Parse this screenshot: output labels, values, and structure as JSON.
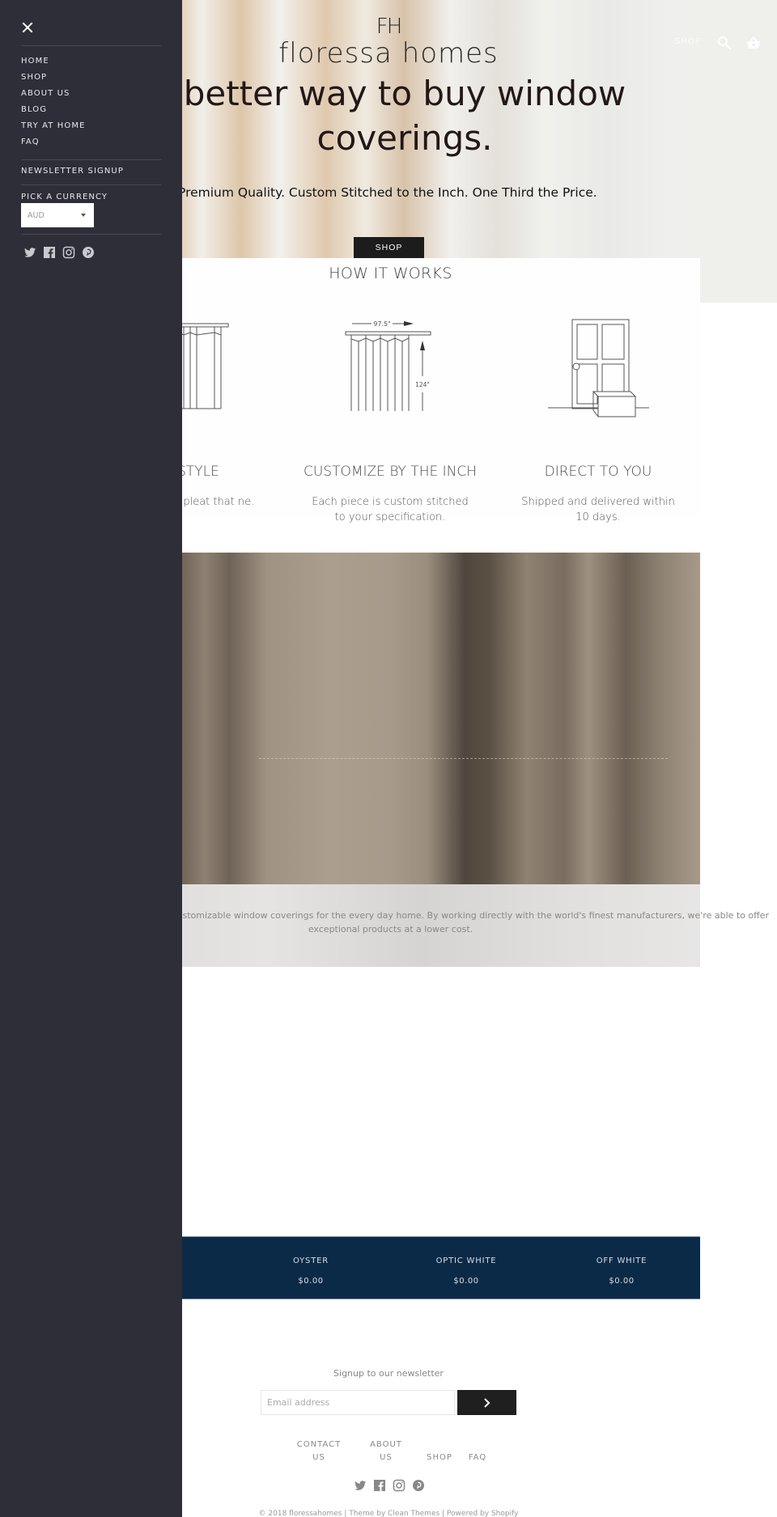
{
  "header": {
    "logo_mark": "FH",
    "logo_text": "floressa homes",
    "nav_shop": "SHOP",
    "search_icon": "search-icon",
    "cart_icon": "basket-icon"
  },
  "hero": {
    "title": "better way to buy window coverings.",
    "subtitle": "Premium Quality. Custom Stitched to the Inch. One Third the Price.",
    "cta_label": "SHOP"
  },
  "how_it_works": {
    "title": "HOW IT WORKS",
    "steps": [
      {
        "title": "STYLE",
        "description": "nd pleat that ne.",
        "icon": "curtain-icon"
      },
      {
        "title": "CUSTOMIZE BY THE INCH",
        "description": "Each piece is custom stitched to your specification.",
        "icon": "curtain-measure-icon",
        "width_label": "97.5\"",
        "height_label": "124\""
      },
      {
        "title": "DIRECT TO YOU",
        "description": "Shipped and delivered within 10 days.",
        "icon": "door-package-icon"
      }
    ]
  },
  "about": {
    "text": "Floressa Homes offers high quality, customizable window coverings for the every day home. By working directly with the world's finest manufacturers, we're able to offer exceptional products at a lower cost."
  },
  "products": [
    {
      "name": "OYSTER",
      "price": "$0.00"
    },
    {
      "name": "OPTIC WHITE",
      "price": "$0.00"
    },
    {
      "name": "OFF WHITE",
      "price": "$0.00"
    }
  ],
  "footer": {
    "newsletter_label": "Signup to our newsletter",
    "email_placeholder": "Email address",
    "submit_icon": "chevron-right-icon",
    "links": [
      {
        "label_line1": "CONTACT",
        "label_line2": "US"
      },
      {
        "label_line1": "ABOUT",
        "label_line2": "US"
      },
      {
        "label_line1": "",
        "label_line2": "SHOP"
      },
      {
        "label_line1": "",
        "label_line2": "FAQ"
      }
    ],
    "social": [
      "twitter-icon",
      "facebook-icon",
      "instagram-icon",
      "pinterest-icon"
    ],
    "copyright": "© 2018 floressahomes  |  Theme by Clean Themes  |  Powered by Shopify"
  },
  "sidebar": {
    "close_icon": "close-icon",
    "menu": [
      "HOME",
      "SHOP",
      "ABOUT US",
      "BLOG",
      "TRY AT HOME",
      "FAQ"
    ],
    "newsletter": "NEWSLETTER SIGNUP",
    "currency_label": "PICK A CURRENCY",
    "currency_value": "AUD",
    "social": [
      "twitter-icon",
      "facebook-icon",
      "instagram-icon",
      "pinterest-icon"
    ]
  },
  "colors": {
    "sidebar_bg": "#2e2e38",
    "product_band_bg": "#0b2a48",
    "button_dark": "#1c1c1c"
  }
}
